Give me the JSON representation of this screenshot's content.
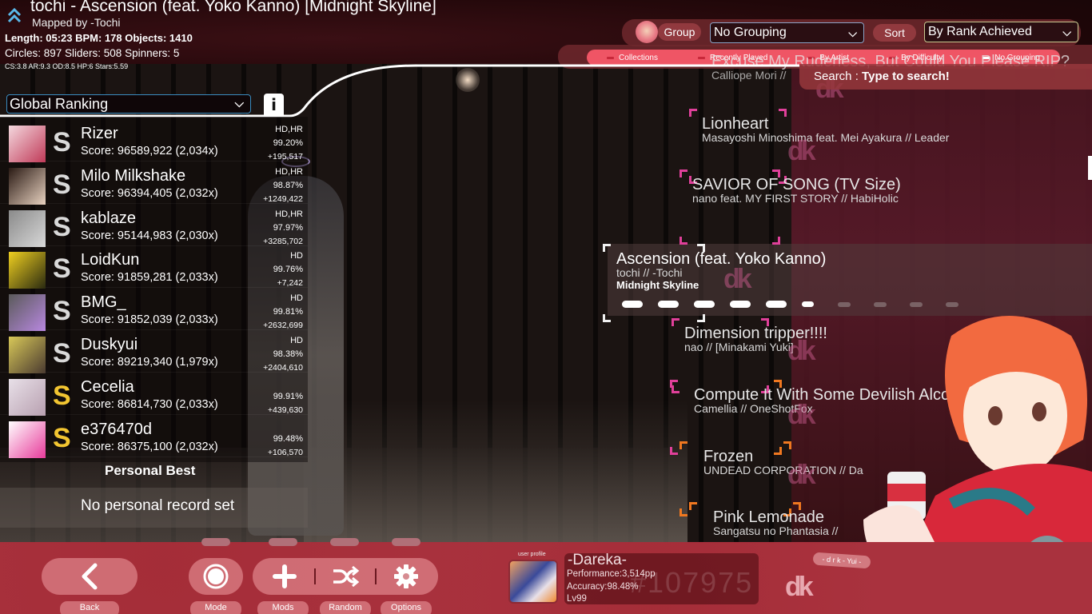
{
  "header": {
    "title": "tochi - Ascension (feat. Yoko Kanno) [Midnight Skyline]",
    "mapper": "Mapped by -Tochi",
    "stats_line1": "Length: 05:23 BPM: 178 Objects: 1410",
    "stats_line2": "Circles: 897 Sliders: 508 Spinners: 5",
    "stats_line3": "CS:3.8 AR:9.3 OD:8.5 HP:6 Stars:5.59",
    "icon": "double-chevron-up-icon"
  },
  "filters": {
    "group_label": "Group",
    "group_value": "No Grouping",
    "sort_label": "Sort",
    "sort_value": "By Rank Achieved",
    "tabs": [
      {
        "label": "Collections",
        "active": false
      },
      {
        "label": "Recently Played",
        "active": false
      },
      {
        "label": "By Artist",
        "active": false
      },
      {
        "label": "By Difficulty",
        "active": false
      },
      {
        "label": "No Grouping",
        "active": true
      }
    ],
    "search_label": "Search :",
    "search_placeholder": "Type to search!"
  },
  "leaderboard": {
    "type_value": "Global Ranking",
    "info_label": "i",
    "entries": [
      {
        "name": "Rizer",
        "grade": "S",
        "grade_color": "silver",
        "score": "Score: 96589,922 (2,034x)",
        "mods": "HD,HR",
        "accuracy": "99.20%",
        "diff": "+195,517",
        "avatar_colors": [
          "#f4d8de",
          "#c03a58"
        ]
      },
      {
        "name": "Milo Milkshake",
        "grade": "S",
        "grade_color": "silver",
        "score": "Score: 96394,405 (2,032x)",
        "mods": "HD,HR",
        "accuracy": "98.87%",
        "diff": "+1249,422",
        "avatar_colors": [
          "#2a1a14",
          "#e8d2c0"
        ]
      },
      {
        "name": "kablaze",
        "grade": "S",
        "grade_color": "silver",
        "score": "Score: 95144,983 (2,030x)",
        "mods": "HD,HR",
        "accuracy": "97.97%",
        "diff": "+3285,702",
        "avatar_colors": [
          "#8a8a8a",
          "#d8d8d8"
        ]
      },
      {
        "name": "LoidKun",
        "grade": "S",
        "grade_color": "silver",
        "score": "Score: 91859,281 (2,033x)",
        "mods": "HD",
        "accuracy": "99.76%",
        "diff": "+7,242",
        "avatar_colors": [
          "#f0d020",
          "#2a2a10"
        ]
      },
      {
        "name": "BMG_",
        "grade": "S",
        "grade_color": "silver",
        "score": "Score: 91852,039 (2,033x)",
        "mods": "HD",
        "accuracy": "99.81%",
        "diff": "+2632,699",
        "avatar_colors": [
          "#5a5a5a",
          "#b888e0"
        ]
      },
      {
        "name": "Duskyui",
        "grade": "S",
        "grade_color": "silver",
        "score": "Score: 89219,340 (1,979x)",
        "mods": "HD",
        "accuracy": "98.38%",
        "diff": "+2404,610",
        "avatar_colors": [
          "#d8c858",
          "#4a3a30"
        ]
      },
      {
        "name": "Cecelia",
        "grade": "S",
        "grade_color": "gold",
        "score": "Score: 86814,730 (2,033x)",
        "mods": "",
        "accuracy": "99.91%",
        "diff": "+439,630",
        "avatar_colors": [
          "#e8e0e8",
          "#b8a0b0"
        ]
      },
      {
        "name": "e376470d",
        "grade": "S",
        "grade_color": "gold",
        "score": "Score: 86375,100 (2,032x)",
        "mods": "",
        "accuracy": "99.48%",
        "diff": "+106,570",
        "avatar_colors": [
          "#ffffff",
          "#e83a9a"
        ]
      }
    ],
    "personal_best_label": "Personal Best",
    "personal_best_empty": "No personal record set"
  },
  "song_list": {
    "items": [
      {
        "title": "Excuse My Rudeness, But Could You Please RIP?",
        "subtitle": "Calliope Mori //",
        "difficulty": "",
        "bracket_color": "none",
        "selected": false
      },
      {
        "title": "Lionheart",
        "subtitle": "Masayoshi Minoshima feat. Mei Ayakura // Leader",
        "difficulty": "",
        "bracket_color": "pink",
        "selected": false
      },
      {
        "title": "SAVIOR OF SONG (TV Size)",
        "subtitle": "nano feat. MY FIRST STORY // HabiHolic",
        "difficulty": "",
        "bracket_color": "pink",
        "selected": false
      },
      {
        "title": "Ascension (feat. Yoko Kanno)",
        "subtitle": "tochi // -Tochi",
        "difficulty": "Midnight Skyline",
        "bracket_color": "white",
        "selected": true,
        "star_rating": 5.59,
        "star_max": 10
      },
      {
        "title": "Dimension tripper!!!!",
        "subtitle": "nao // [Minakami Yuki]",
        "difficulty": "",
        "bracket_color": "pink",
        "selected": false
      },
      {
        "title": "Compute It With Some Devilish Alcohol",
        "subtitle": "Camellia // OneShotFox",
        "difficulty": "",
        "bracket_color": "pink-orange",
        "selected": false
      },
      {
        "title": "Frozen",
        "subtitle": "UNDEAD CORPORATION // Da",
        "difficulty": "",
        "bracket_color": "orange",
        "selected": false
      },
      {
        "title": "Pink Lemonade",
        "subtitle": "Sangatsu no Phantasia //",
        "difficulty": "",
        "bracket_color": "orange",
        "selected": false
      }
    ]
  },
  "footer": {
    "buttons": [
      {
        "label": "Back",
        "icon": "chevron-left-icon"
      },
      {
        "label": "Mode",
        "icon": "osu-circle-icon"
      },
      {
        "label": "Mods",
        "icon": "plus-icon"
      },
      {
        "label": "Random",
        "icon": "shuffle-icon"
      },
      {
        "label": "Options",
        "icon": "gear-icon"
      }
    ],
    "user": {
      "profile_label": "user profile",
      "name": "-Dareka-",
      "performance": "Performance:3,514pp",
      "accuracy": "Accuracy:98.48%",
      "level": "Lv99",
      "rank": "#107975"
    },
    "skin_tag": "- d r k - Yui -",
    "skin_logo": "dk"
  },
  "colors": {
    "accent": "#ef5565",
    "footer_bg": "#a9323e",
    "grade_silver": "#d9d9d9",
    "grade_gold": "#f2c531",
    "bracket_pink": "#e0409a",
    "bracket_orange": "#f07820",
    "header_icon": "#5ab8e8"
  }
}
